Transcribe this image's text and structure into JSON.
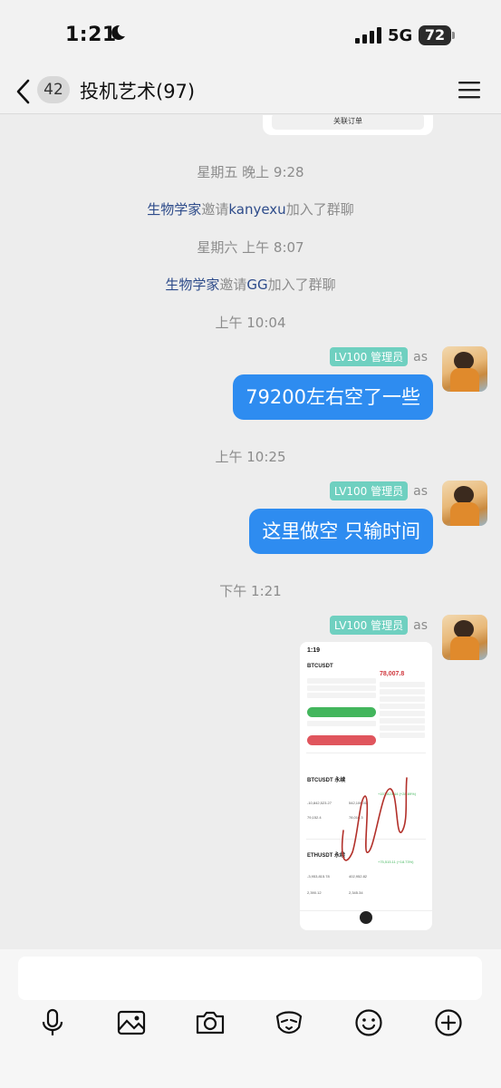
{
  "status": {
    "time": "1:21",
    "network": "5G",
    "battery": "72"
  },
  "nav": {
    "unread_count": "42",
    "title": "投机艺术(97)"
  },
  "chat": {
    "top_card_button": "关联订单",
    "events": [
      {
        "time": "星期五 晚上 9:28"
      },
      {
        "inviter": "生物学家",
        "verb": "邀请",
        "invitee": "kanyexu",
        "suffix": "加入了群聊"
      },
      {
        "time": "星期六 上午 8:07"
      },
      {
        "inviter": "生物学家",
        "verb": "邀请",
        "invitee": "GG",
        "suffix": "加入了群聊"
      },
      {
        "time": "上午 10:04"
      },
      {
        "time": "上午 10:25"
      },
      {
        "time": "下午 1:21"
      }
    ],
    "messages": [
      {
        "badge": "LV100 管理员",
        "sender": "as",
        "text": "79200左右空了一些"
      },
      {
        "badge": "LV100 管理员",
        "sender": "as",
        "text": "这里做空 只输时间"
      },
      {
        "badge": "LV100 管理员",
        "sender": "as",
        "image": "trading-screenshot"
      }
    ],
    "screenshot": {
      "status_time": "1:19",
      "pair": "BTCUSDT",
      "price": "78,007.8",
      "position1": "BTCUSDT 永续",
      "position1_pnl": "+157,823.44 (+28.69%)",
      "position1_size": "-10,842,523.27",
      "position1_margin": "542,106.01",
      "position1_entry": "79,152.4",
      "position1_mark": "78,016.3",
      "position2": "ETHUSDT 永续",
      "position2_pnl": "+75,515.11 (+18.73%)",
      "position2_size": "-3,953,815.78",
      "position2_margin": "402,952.82",
      "position2_entry": "2,390.12",
      "position2_mark": "2,345.34"
    }
  },
  "toolbar": {
    "icons": [
      "microphone-icon",
      "image-icon",
      "camera-icon",
      "red-packet-icon",
      "emoji-icon",
      "plus-icon"
    ]
  },
  "colors": {
    "bubble": "#2e8cf0",
    "badge": "#6fd0c0",
    "link": "#2d4b8a"
  }
}
